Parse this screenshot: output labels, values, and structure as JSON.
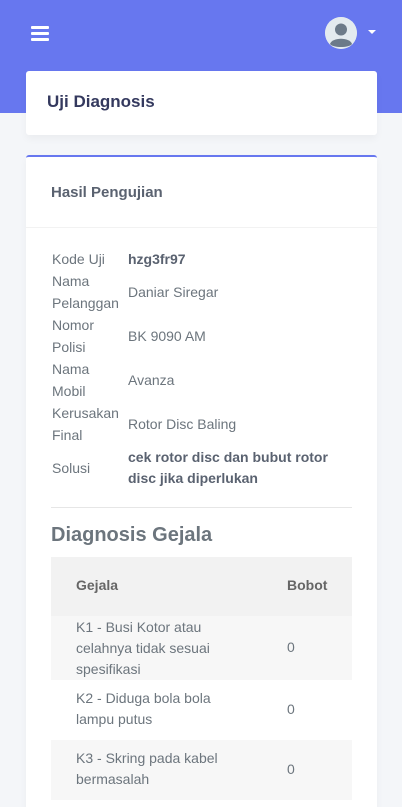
{
  "header": {
    "menu_icon": "hamburger-icon",
    "avatar_icon": "user-avatar-icon",
    "dropdown_icon": "caret-down-icon"
  },
  "page": {
    "title": "Uji Diagnosis"
  },
  "result_card": {
    "title": "Hasil Pengujian",
    "fields": [
      {
        "label": "Kode Uji",
        "value": "hzg3fr97"
      },
      {
        "label": "Nama Pelanggan",
        "value": "Daniar Siregar"
      },
      {
        "label": "Nomor Polisi",
        "value": "BK 9090 AM"
      },
      {
        "label": "Nama Mobil",
        "value": "Avanza"
      },
      {
        "label": "Kerusakan Final",
        "value": "Rotor Disc Baling"
      },
      {
        "label": "Solusi",
        "value": "cek rotor disc dan bubut rotor disc jika diperlukan"
      }
    ]
  },
  "diagnosis": {
    "title": "Diagnosis Gejala",
    "columns": [
      "Gejala",
      "Bobot"
    ],
    "rows": [
      {
        "gejala": "K1 - Busi Kotor atau celahnya tidak sesuai spesifikasi",
        "bobot": "0"
      },
      {
        "gejala": "K2 - Diduga bola bola lampu putus",
        "bobot": "0"
      },
      {
        "gejala": "K3 - Skring pada kabel bermasalah",
        "bobot": "0"
      }
    ]
  },
  "colors": {
    "primary": "#6777ef",
    "background": "#f4f6f9"
  }
}
